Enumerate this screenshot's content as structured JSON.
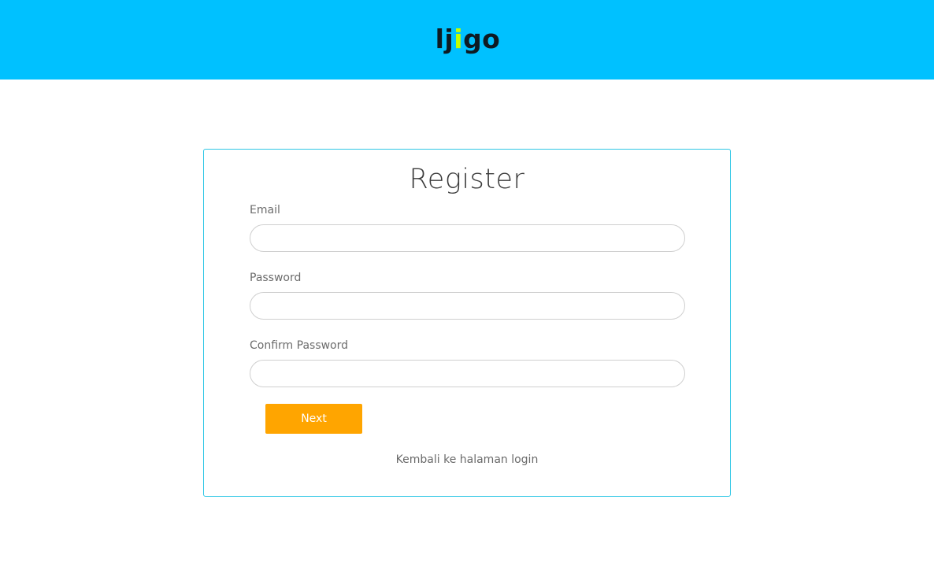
{
  "header": {
    "logo": {
      "prefix": "lj",
      "dot": "i",
      "suffix": "go"
    },
    "background_color": "#00c1ff"
  },
  "register": {
    "title": "Register",
    "email_label": "Email",
    "email_value": "",
    "password_label": "Password",
    "password_value": "",
    "confirm_label": "Confirm Password",
    "confirm_value": "",
    "next_label": "Next",
    "back_link": "Kembali ke halaman login",
    "accent_color": "#ffa500",
    "border_color": "#2fc7e6"
  }
}
